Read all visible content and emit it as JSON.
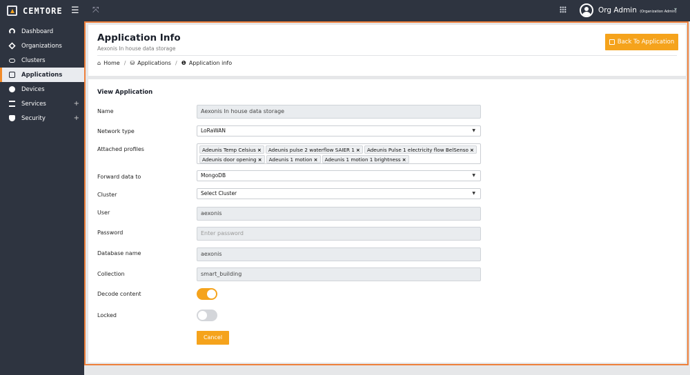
{
  "brand": {
    "name": "CEMTORE"
  },
  "topbar": {
    "user_name": "Org Admin",
    "user_role": "(Organization Admin)"
  },
  "sidebar": {
    "items": [
      {
        "label": "Dashboard",
        "icon": "dashboard-icon"
      },
      {
        "label": "Organizations",
        "icon": "organizations-icon"
      },
      {
        "label": "Clusters",
        "icon": "cloud-icon"
      },
      {
        "label": "Applications",
        "icon": "database-icon",
        "active": true
      },
      {
        "label": "Devices",
        "icon": "devices-icon"
      },
      {
        "label": "Services",
        "icon": "services-icon",
        "expand": "+"
      },
      {
        "label": "Security",
        "icon": "shield-icon",
        "expand": "+"
      }
    ]
  },
  "header": {
    "title": "Application Info",
    "subtitle": "Aexonis In house data storage",
    "back_button": "Back To Application",
    "breadcrumb": [
      "Home",
      "Applications",
      "Application info"
    ]
  },
  "form": {
    "section_title": "View Application",
    "name": {
      "label": "Name",
      "value": "Aexonis In house data storage"
    },
    "network_type": {
      "label": "Network type",
      "value": "LoRaWAN"
    },
    "attached_profiles": {
      "label": "Attached profiles",
      "tags": [
        "Adeunis Temp Celsius",
        "Adeunis pulse 2 waterflow SAIER 1",
        "Adeunis Pulse 1 electricity flow BelSenso",
        "Adeunis door opening",
        "Adeunis 1 motion",
        "Adeunis 1 motion 1 brightness"
      ]
    },
    "forward_data_to": {
      "label": "Forward data to",
      "value": "MongoDB"
    },
    "cluster": {
      "label": "Cluster",
      "value": "Select Cluster"
    },
    "user": {
      "label": "User",
      "value": "aexonis"
    },
    "password": {
      "label": "Password",
      "placeholder": "Enter password"
    },
    "database_name": {
      "label": "Database name",
      "value": "aexonis"
    },
    "collection": {
      "label": "Collection",
      "value": "smart_building"
    },
    "decode_content": {
      "label": "Decode content",
      "on": true
    },
    "locked": {
      "label": "Locked",
      "on": false
    },
    "cancel_button": "Cancel"
  },
  "colors": {
    "accent": "#f5a31c",
    "sidebar_bg": "#2e3440",
    "highlight_frame": "#ee7f3a"
  }
}
